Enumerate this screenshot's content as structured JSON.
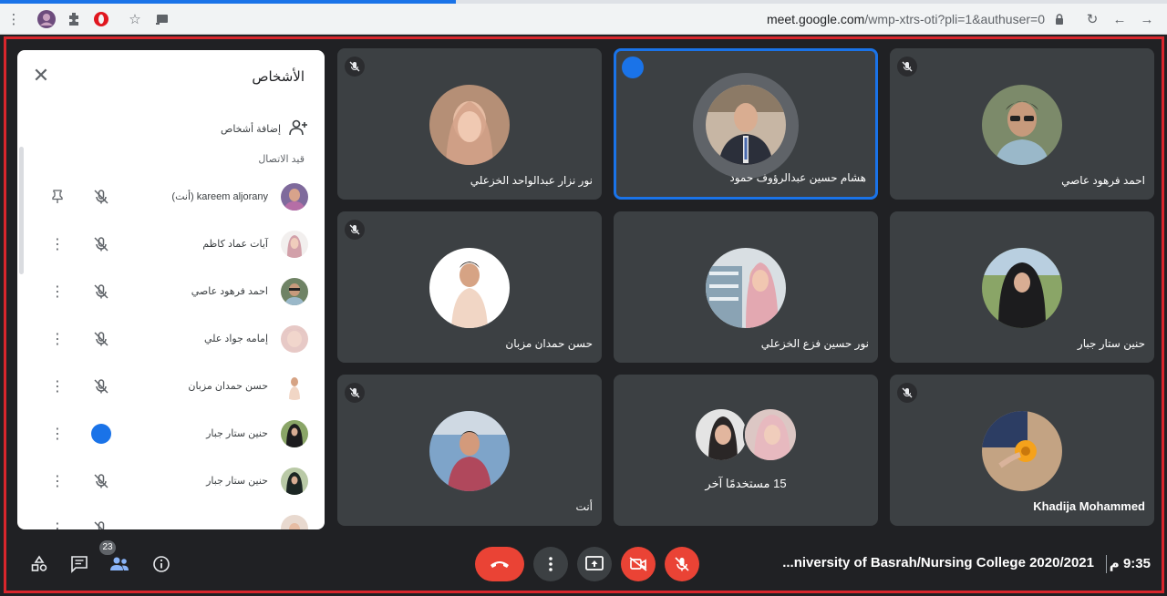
{
  "browser": {
    "url_host": "meet.google.com",
    "url_path": "/wmp-xtrs-oti?pli=1&authuser=0"
  },
  "panel": {
    "title": "الأشخاص",
    "add_label": "إضافة أشخاص",
    "section_label": "قيد الاتصال",
    "people": [
      {
        "name": "kareem aljorany (أنت)",
        "action": "pin",
        "status": "muted"
      },
      {
        "name": "آيات عماد كاظم",
        "action": "more",
        "status": "muted"
      },
      {
        "name": "احمد فرهود عاصي",
        "action": "more",
        "status": "muted"
      },
      {
        "name": "إمامه جواد علي",
        "action": "more",
        "status": "muted"
      },
      {
        "name": "حسن حمدان مزبان",
        "action": "more",
        "status": "muted"
      },
      {
        "name": "حنين ستار جبار",
        "action": "more",
        "status": "speaking"
      },
      {
        "name": "حنين ستار جبار",
        "action": "more",
        "status": "muted"
      }
    ]
  },
  "tiles": [
    {
      "name": "نور نزار عبدالواحد الخزعلي",
      "muted": true,
      "active": false
    },
    {
      "name": "هشام حسين عبدالرؤوف حمود",
      "muted": false,
      "active": true
    },
    {
      "name": "احمد فرهود عاصي",
      "muted": true,
      "active": false
    },
    {
      "name": "حسن حمدان مزبان",
      "muted": true,
      "active": false
    },
    {
      "name": "نور حسين فزع الخزعلي",
      "muted": false,
      "active": false
    },
    {
      "name": "حنين ستار جبار",
      "muted": false,
      "active": false
    },
    {
      "name": "أنت",
      "muted": true,
      "active": false
    },
    {
      "name": "15 مستخدمًا آخر",
      "muted": false,
      "active": false
    },
    {
      "name": "Khadija Mohammed",
      "muted": true,
      "active": false
    }
  ],
  "bottom": {
    "people_count": "23",
    "meeting_title": "...niversity of Basrah/Nursing College 2020/2021",
    "time": "9:35 م"
  },
  "colors": {
    "accent": "#1a73e8",
    "danger": "#ea4335",
    "tile_bg": "#3c4043",
    "page_bg": "#202124",
    "frame_border": "#d9262c"
  }
}
